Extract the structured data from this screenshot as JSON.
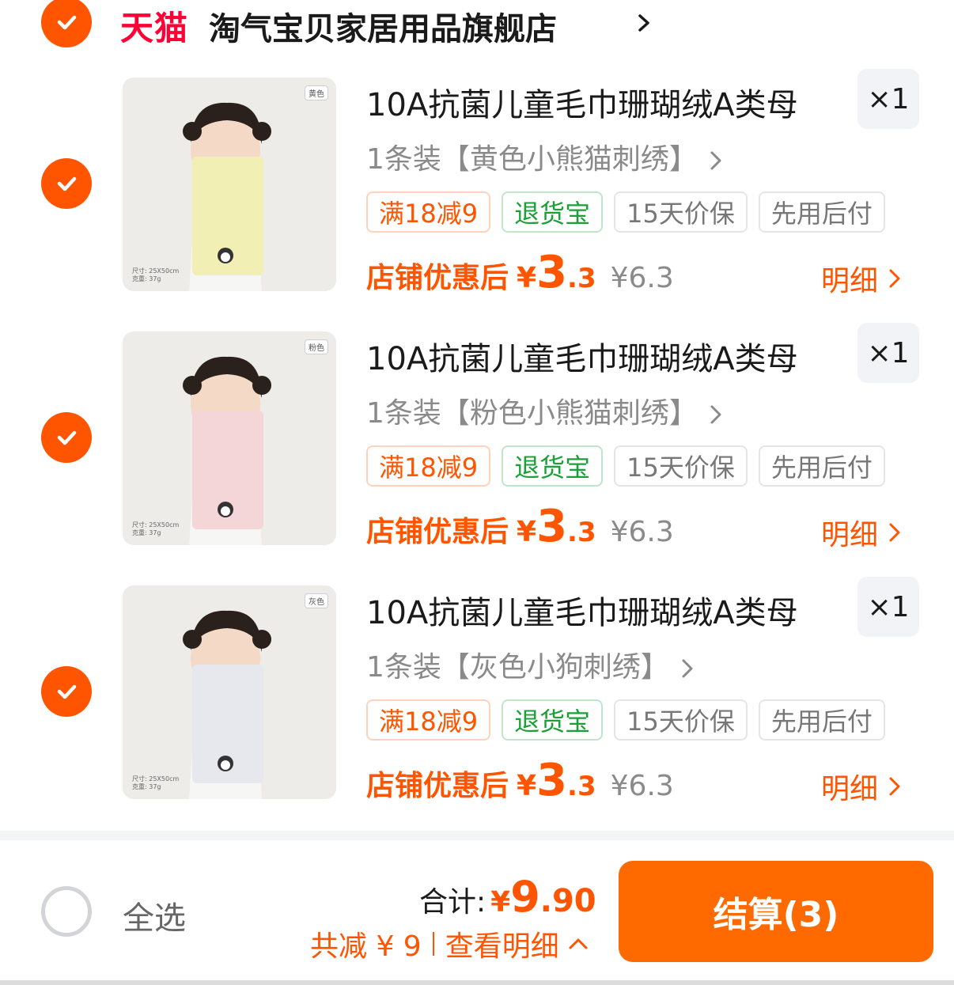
{
  "store": {
    "brand": "天猫",
    "name": "淘气宝贝家居用品旗舰店",
    "selected": true
  },
  "items": [
    {
      "title": "10A抗菌儿童毛巾珊瑚绒A类母",
      "sku": "1条装【黄色小熊猫刺绣】",
      "quantity": "×1",
      "color_tag": "黄色",
      "size_note_1": "尺寸: 25X50cm",
      "size_note_2": "克重: 37g",
      "towel_color": "#f2efb4",
      "tags": [
        "满18减9",
        "退货宝",
        "15天价保",
        "先用后付"
      ],
      "price_label": "店铺优惠后",
      "price_currency": "¥",
      "price_int": "3",
      "price_dec": ".3",
      "original_price": "¥6.3",
      "detail_label": "明细",
      "selected": true
    },
    {
      "title": "10A抗菌儿童毛巾珊瑚绒A类母",
      "sku": "1条装【粉色小熊猫刺绣】",
      "quantity": "×1",
      "color_tag": "粉色",
      "size_note_1": "尺寸: 25X50cm",
      "size_note_2": "克重: 37g",
      "towel_color": "#f4d6d8",
      "tags": [
        "满18减9",
        "退货宝",
        "15天价保",
        "先用后付"
      ],
      "price_label": "店铺优惠后",
      "price_currency": "¥",
      "price_int": "3",
      "price_dec": ".3",
      "original_price": "¥6.3",
      "detail_label": "明细",
      "selected": true
    },
    {
      "title": "10A抗菌儿童毛巾珊瑚绒A类母",
      "sku": "1条装【灰色小狗刺绣】",
      "quantity": "×1",
      "color_tag": "灰色",
      "size_note_1": "尺寸: 25X50cm",
      "size_note_2": "克重: 37g",
      "towel_color": "#e6e8ee",
      "tags": [
        "满18减9",
        "退货宝",
        "15天价保",
        "先用后付"
      ],
      "price_label": "店铺优惠后",
      "price_currency": "¥",
      "price_int": "3",
      "price_dec": ".3",
      "original_price": "¥6.3",
      "detail_label": "明细",
      "selected": true
    }
  ],
  "footer": {
    "select_all_label": "全选",
    "total_label": "合计:",
    "total_currency": "¥",
    "total_int": "9",
    "total_dec": ".90",
    "discount_text": "共减 ¥ 9",
    "view_detail_label": "查看明细",
    "checkout_label": "结算(3)"
  },
  "colors": {
    "accent": "#ff5500",
    "checkout": "#ff6a00",
    "tmall_red": "#ff0036",
    "returns_green": "#1aa036"
  }
}
